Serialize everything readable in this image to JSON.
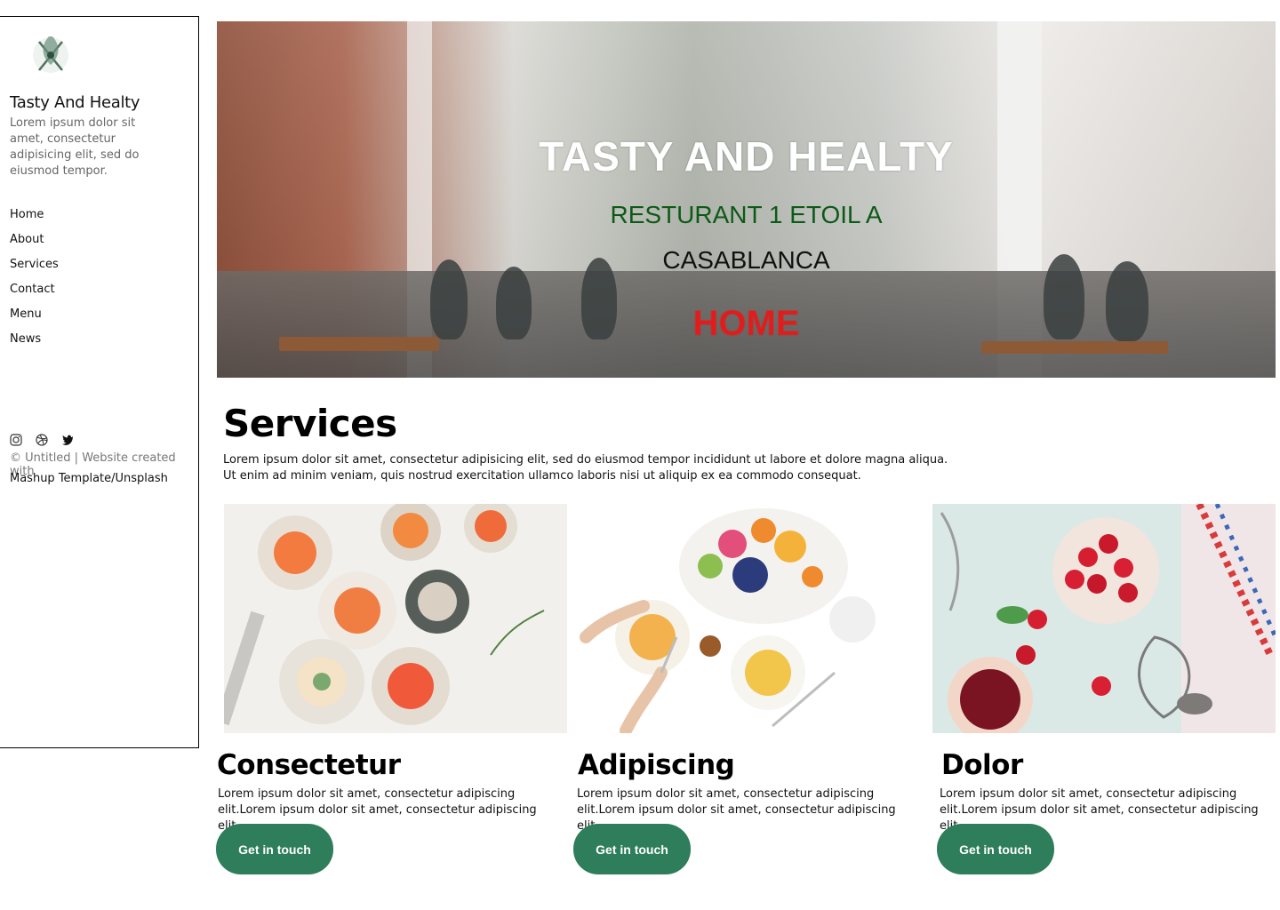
{
  "sidebar": {
    "logo_icon": "fork-knife-leaf-icon",
    "title": "Tasty And Healty",
    "description": "Lorem ipsum dolor sit amet, consectetur adipisicing elit, sed do eiusmod tempor.",
    "nav": [
      "Home",
      "About",
      "Services",
      "Contact",
      "Menu",
      "News"
    ],
    "social_icons": [
      "instagram-icon",
      "dribbble-icon",
      "twitter-icon"
    ],
    "footer_line1": "© Untitled | Website created with",
    "footer_line2": "Mashup Template/Unsplash"
  },
  "hero": {
    "title": "TASTY AND HEALTY",
    "subtitle1": "RESTURANT 1 ETOIL A",
    "subtitle2": "CASABLANCA",
    "cta": "HOME"
  },
  "services": {
    "title": "Services",
    "description_line1": "Lorem ipsum dolor sit amet, consectetur adipisicing elit, sed do eiusmod tempor incididunt ut labore et dolore magna aliqua.",
    "description_line2": "Ut enim ad minim veniam, quis nostrud exercitation ullamco laboris nisi ut aliquip ex ea commodo consequat.",
    "cards": [
      {
        "title": "Consectetur",
        "text": "Lorem ipsum dolor sit amet, consectetur adipiscing elit.Lorem ipsum dolor sit amet, consectetur adipiscing elit.",
        "button": "Get in touch"
      },
      {
        "title": "Adipiscing",
        "text": "Lorem ipsum dolor sit amet, consectetur adipiscing elit.Lorem ipsum dolor sit amet, consectetur adipiscing elit.",
        "button": "Get in touch"
      },
      {
        "title": "Dolor",
        "text": "Lorem ipsum dolor sit amet, consectetur adipiscing elit.Lorem ipsum dolor sit amet, consectetur adipiscing elit.",
        "button": "Get in touch"
      }
    ]
  },
  "colors": {
    "accent": "#2e7d5b",
    "hero_subtitle": "#0d5a17",
    "hero_cta": "#e21b1b"
  }
}
